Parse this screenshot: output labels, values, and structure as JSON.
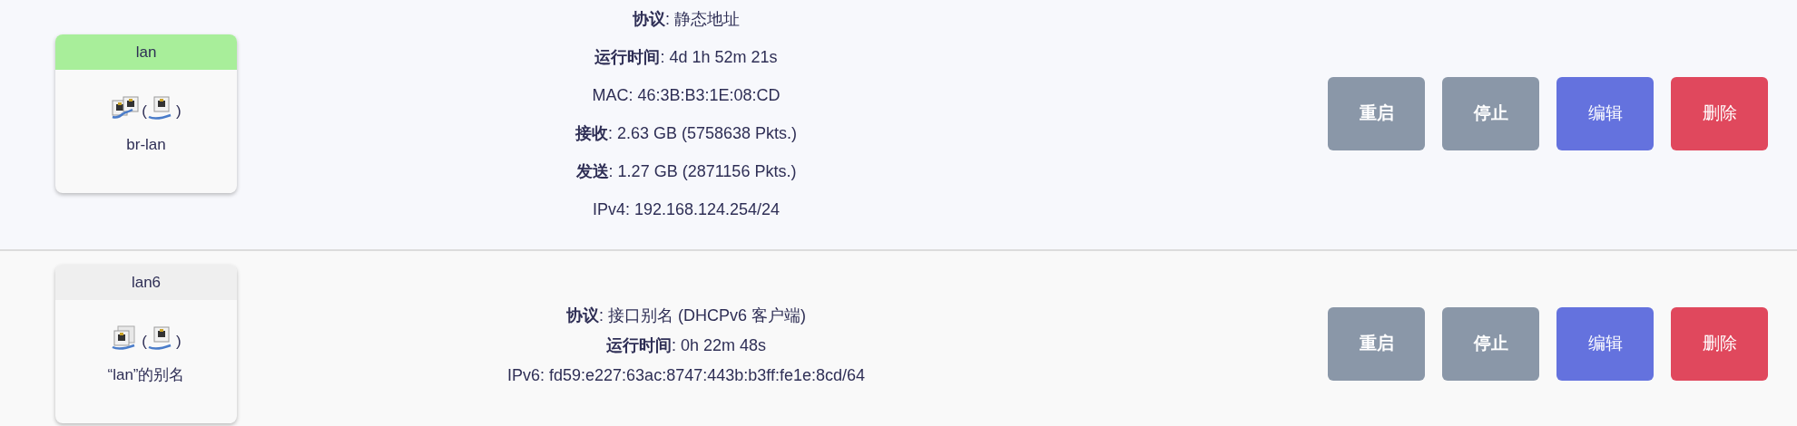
{
  "interfaces": [
    {
      "name": "lan",
      "color": "#a8ee9a",
      "device": {
        "main_icon": {
          "kind": "bridge"
        },
        "open": "(",
        "sub_icon": {
          "kind": "ethernet"
        },
        "close": ")",
        "label": "br-lan"
      },
      "dense": false,
      "info": [
        "**协议**: 静态地址",
        "**运行时间**: 4d 1h 52m 21s",
        "MAC: 46:3B:B3:1E:08:CD",
        "**接收**: 2.63 GB (5758638 Pkts.)",
        "**发送**: 1.27 GB (2871156 Pkts.)",
        "IPv4: 192.168.124.254/24"
      ],
      "buttons": [
        {
          "label": "重启",
          "kind": "neutral"
        },
        {
          "label": "停止",
          "kind": "neutral"
        },
        {
          "label": "编辑",
          "kind": "primary"
        },
        {
          "label": "删除",
          "kind": "danger"
        }
      ]
    },
    {
      "name": "lan6",
      "color": "#efefef",
      "device": {
        "main_icon": {
          "kind": "alias"
        },
        "open": "(",
        "sub_icon": {
          "kind": "ethernet"
        },
        "close": ")",
        "label": "“lan”的别名"
      },
      "dense": true,
      "info": [
        "**协议**: 接口别名 (DHCPv6 客户端)",
        "**运行时间**: 0h 22m 48s",
        "IPv6: fd59:e227:63ac:8747:443b:b3ff:fe1e:8cd/64"
      ],
      "buttons": [
        {
          "label": "重启",
          "kind": "neutral"
        },
        {
          "label": "停止",
          "kind": "neutral"
        },
        {
          "label": "编辑",
          "kind": "primary"
        },
        {
          "label": "删除",
          "kind": "danger"
        }
      ]
    }
  ]
}
